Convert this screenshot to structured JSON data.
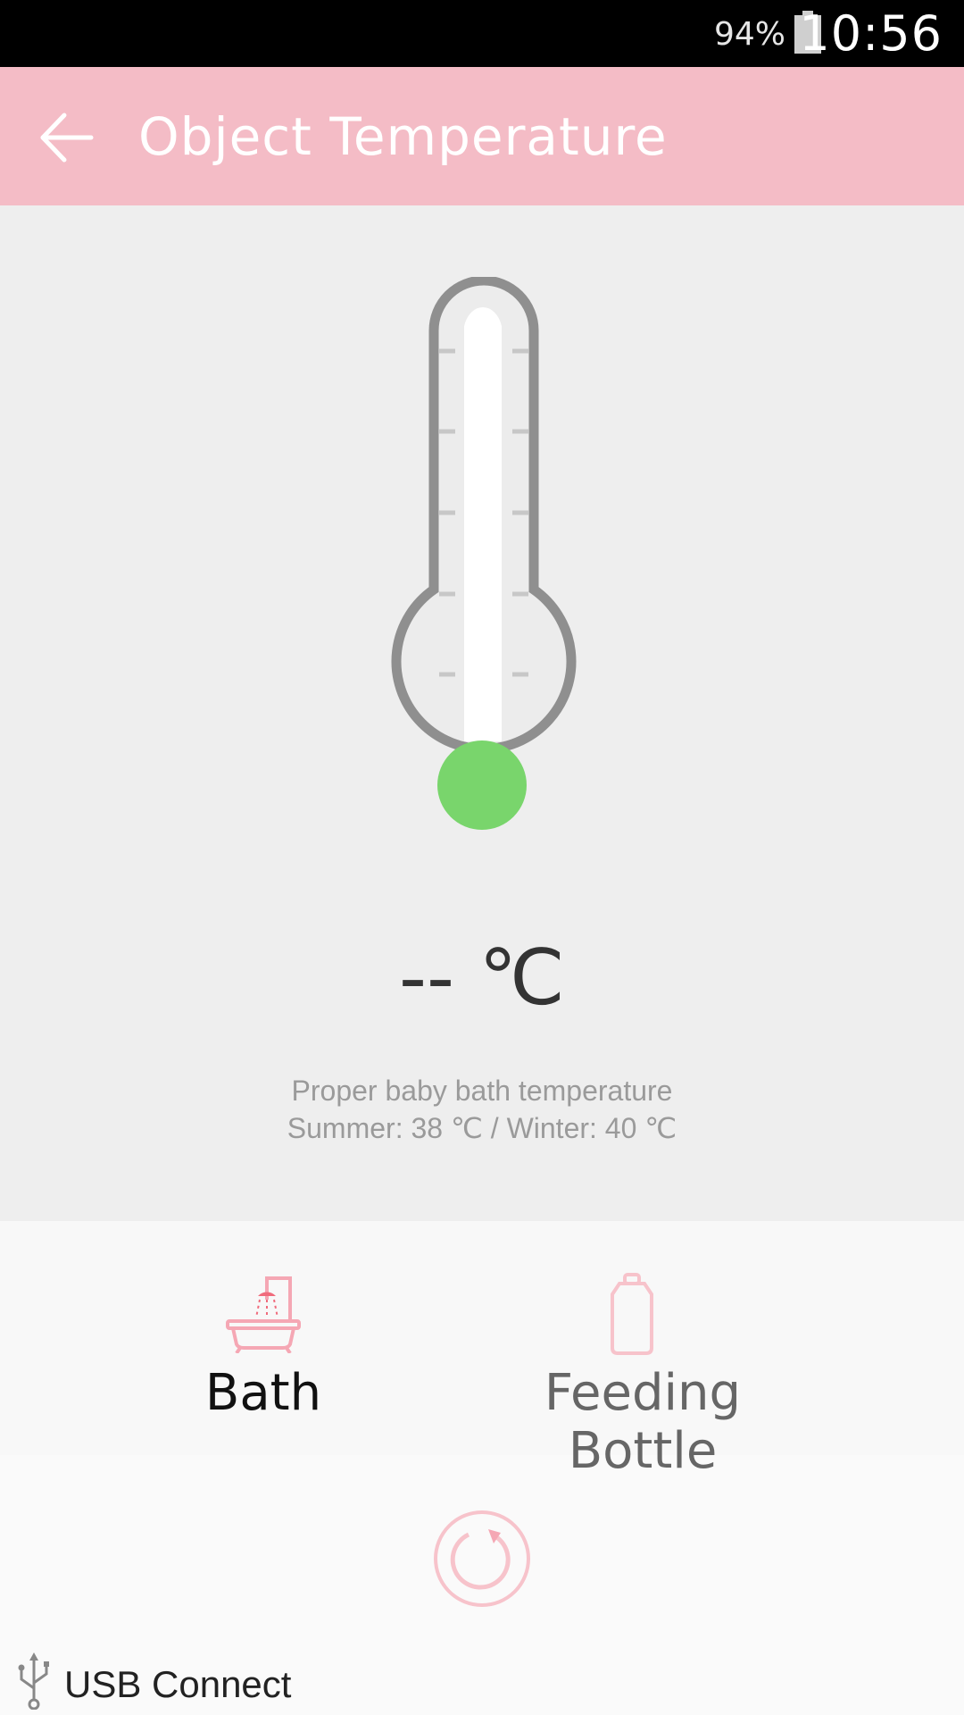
{
  "status_bar": {
    "battery_percent": "94%",
    "time": "10:56"
  },
  "app_bar": {
    "title": "Object Temperature",
    "back_icon": "arrow-left-icon"
  },
  "reading": {
    "value": "-- ℃",
    "bulb_color": "#79d56c"
  },
  "hint": {
    "line1": "Proper baby bath temperature",
    "line2": "Summer: 38 ℃ / Winter: 40 ℃"
  },
  "modes": {
    "selected": "Bath",
    "items": [
      {
        "label": "Bath",
        "icon": "bathtub-icon"
      },
      {
        "label": "Feeding Bottle",
        "icon": "bottle-icon"
      }
    ]
  },
  "refresh": {
    "icon": "refresh-icon"
  },
  "usb": {
    "label": "USB Connect",
    "icon": "usb-icon"
  },
  "colors": {
    "accent": "#f4bcc6",
    "icon_pink": "#f5a7b4",
    "bulb_green": "#79d56c"
  }
}
